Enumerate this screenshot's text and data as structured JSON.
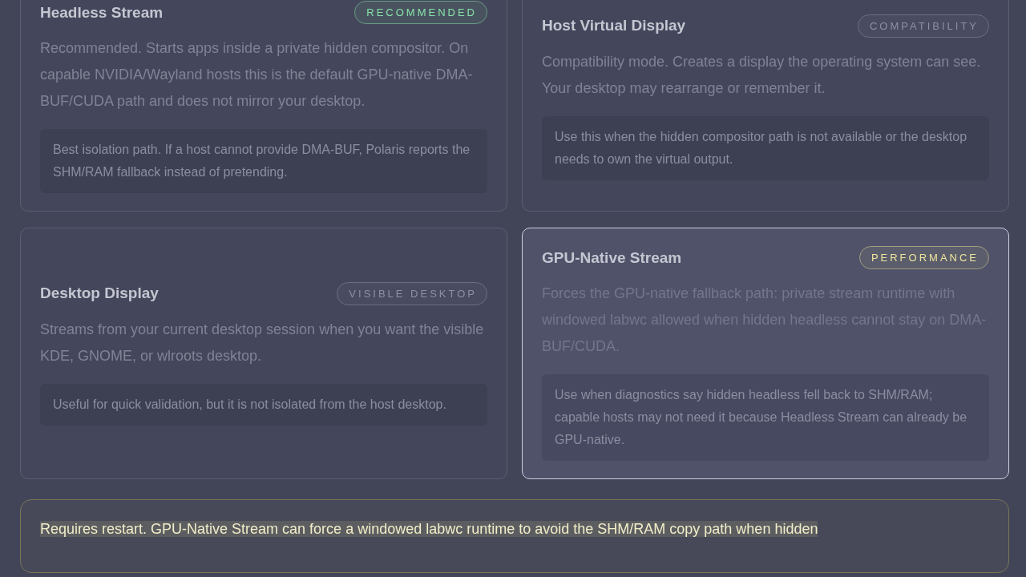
{
  "modes": [
    {
      "title": "Headless Stream",
      "badge": {
        "label": "RECOMMENDED",
        "color": "#86e0a6"
      },
      "description": "Recommended. Starts apps inside a private hidden compositor. On capable NVIDIA/Wayland hosts this is the default GPU-native DMA-BUF/CUDA path and does not mirror your desktop.",
      "note": "Best isolation path. If a host cannot provide DMA-BUF, Polaris reports the SHM/RAM fallback instead of pretending.",
      "selected": false
    },
    {
      "title": "Host Virtual Display",
      "badge": {
        "label": "COMPATIBILITY",
        "color": "#8d90a2"
      },
      "description": "Compatibility mode. Creates a display the operating system can see. Your desktop may rearrange or remember it.",
      "note": "Use this when the hidden compositor path is not available or the desktop needs to own the virtual output.",
      "selected": false
    },
    {
      "title": "Desktop Display",
      "badge": {
        "label": "VISIBLE DESKTOP",
        "color": "#8d90a2"
      },
      "description": "Streams from your current desktop session when you want the visible KDE, GNOME, or wlroots desktop.",
      "note": "Useful for quick validation, but it is not isolated from the host desktop.",
      "selected": false
    },
    {
      "title": "GPU-Native Stream",
      "badge": {
        "label": "PERFORMANCE",
        "color": "#ece59c"
      },
      "description": "Forces the GPU-native fallback path: private stream runtime with windowed labwc allowed when hidden headless cannot stay on DMA-BUF/CUDA.",
      "note": "Use when diagnostics say hidden headless fell back to SHM/RAM; capable hosts may not need it because Headless Stream can already be GPU-native.",
      "selected": true
    }
  ],
  "notice": "Requires restart. GPU-Native Stream can force a windowed labwc runtime to avoid the SHM/RAM copy path when hidden"
}
